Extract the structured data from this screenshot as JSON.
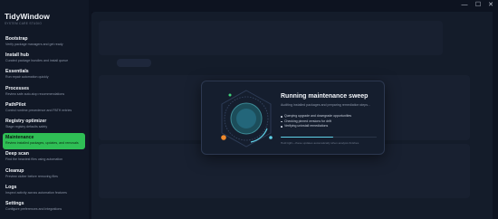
{
  "app": {
    "title": "TidyWindow",
    "subtitle": "SYSTEM CARE STUDIO"
  },
  "window_controls": {
    "minimize": "—",
    "maximize": "☐",
    "close": "✕"
  },
  "sidebar": {
    "items": [
      {
        "label": "Bootstrap",
        "desc": "Verify package managers and get ready"
      },
      {
        "label": "Install hub",
        "desc": "Curated package bundles and install queue"
      },
      {
        "label": "Essentials",
        "desc": "Run repair automation quickly"
      },
      {
        "label": "Processes",
        "desc": "Review safe auto-stop recommendations"
      },
      {
        "label": "PathPilot",
        "desc": "Control runtime precedence and PATH entries"
      },
      {
        "label": "Registry optimizer",
        "desc": "Stage registry defaults safely"
      },
      {
        "label": "Maintenance",
        "desc": "Review installed packages, updates, and removals",
        "active": true
      },
      {
        "label": "Deep scan",
        "desc": "Find the heaviest files using automation"
      },
      {
        "label": "Cleanup",
        "desc": "Preview clutter before removing files"
      },
      {
        "label": "Logs",
        "desc": "Inspect activity across automation features"
      },
      {
        "label": "Settings",
        "desc": "Configure preferences and integrations"
      }
    ]
  },
  "modal": {
    "title": "Running maintenance sweep",
    "subtitle": "Auditing installed packages and preparing remediation steps...",
    "steps": [
      "Querying upgrade and downgrade opportunities",
      "Checking pinned versions for drift",
      "Verifying uninstall remediations"
    ],
    "progress": 0.55,
    "note": "Hold tight—these updates automatically when analysis finishes."
  },
  "colors": {
    "accent": "#2fbf55",
    "progress": "#5fd1e8",
    "orb_orange": "#f08a2c",
    "orb_green": "#3fd17a",
    "orb_teal": "#5fd1e8"
  }
}
